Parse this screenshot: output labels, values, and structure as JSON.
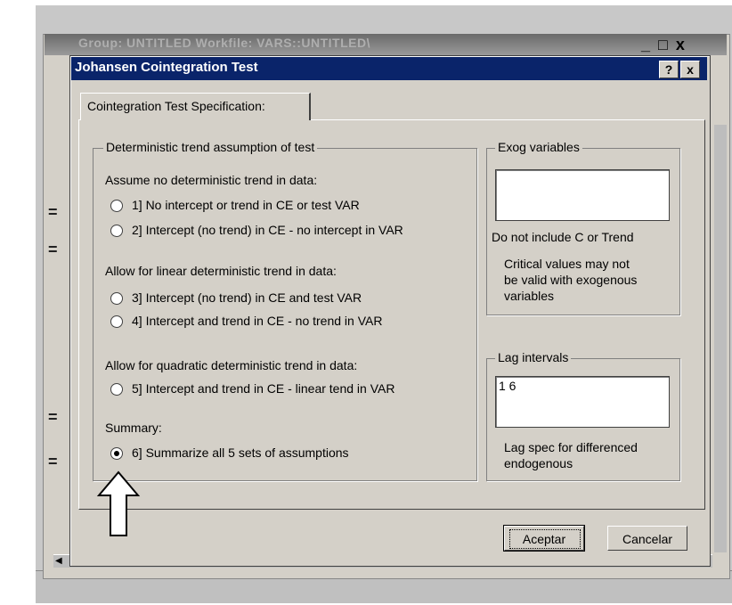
{
  "background_window": {
    "title": "Group: UNTITLED   Workfile: VARS::UNTITLED\\",
    "controls": "_ □ x"
  },
  "dialog": {
    "title": "Johansen Cointegration Test",
    "help": "?",
    "close": "x"
  },
  "tab": {
    "label": "Cointegration Test Specification:"
  },
  "trend_group": {
    "legend": "Deterministic trend assumption of test",
    "section_none": "Assume no deterministic trend in data:",
    "option1": "1]   No intercept or trend in CE or test VAR",
    "option2": "2]   Intercept (no trend) in CE - no intercept in VAR",
    "section_linear": "Allow for linear deterministic trend in data:",
    "option3": "3]   Intercept (no trend) in CE and test VAR",
    "option4": "4]   Intercept and trend in CE - no trend in VAR",
    "section_quadratic": "Allow for quadratic deterministic trend in data:",
    "option5": "5]   Intercept and trend in CE - linear tend in VAR",
    "section_summary": "Summary:",
    "option6": "6]   Summarize all 5 sets of assumptions",
    "selected": 6
  },
  "exog_group": {
    "legend": "Exog variables",
    "value": "",
    "note1": "Do not include C or Trend",
    "note2_line1": "Critical values may not",
    "note2_line2": "be valid with exogenous",
    "note2_line3": "variables"
  },
  "lag_group": {
    "legend": "Lag intervals",
    "value": "1 6",
    "note_line1": "Lag spec for differenced",
    "note_line2": "endogenous"
  },
  "buttons": {
    "ok": "Aceptar",
    "cancel": "Cancelar"
  }
}
